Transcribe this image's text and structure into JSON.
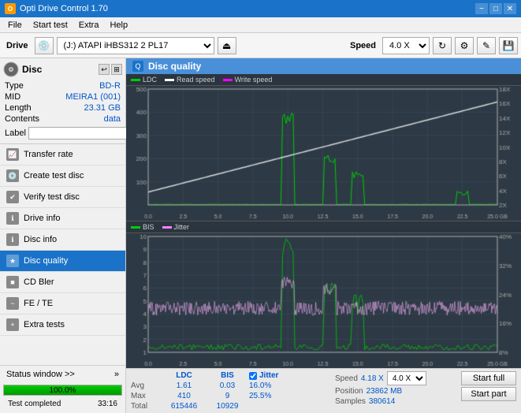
{
  "titleBar": {
    "icon": "O",
    "title": "Opti Drive Control 1.70",
    "minimizeLabel": "−",
    "maximizeLabel": "□",
    "closeLabel": "✕"
  },
  "menuBar": {
    "items": [
      "File",
      "Start test",
      "Extra",
      "Help"
    ]
  },
  "toolbar": {
    "driveLabel": "Drive",
    "driveValue": "(J:)  ATAPI iHBS312  2 PL17",
    "speedLabel": "Speed",
    "speedValue": "4.0 X"
  },
  "disc": {
    "title": "Disc",
    "type": {
      "label": "Type",
      "value": "BD-R"
    },
    "mid": {
      "label": "MID",
      "value": "MEIRA1 (001)"
    },
    "length": {
      "label": "Length",
      "value": "23.31 GB"
    },
    "contents": {
      "label": "Contents",
      "value": "data"
    },
    "label": {
      "label": "Label",
      "placeholder": ""
    }
  },
  "nav": {
    "items": [
      {
        "id": "transfer-rate",
        "label": "Transfer rate",
        "active": false
      },
      {
        "id": "create-test-disc",
        "label": "Create test disc",
        "active": false
      },
      {
        "id": "verify-test-disc",
        "label": "Verify test disc",
        "active": false
      },
      {
        "id": "drive-info",
        "label": "Drive info",
        "active": false
      },
      {
        "id": "disc-info",
        "label": "Disc info",
        "active": false
      },
      {
        "id": "disc-quality",
        "label": "Disc quality",
        "active": true
      },
      {
        "id": "cd-bler",
        "label": "CD Bler",
        "active": false
      },
      {
        "id": "fe-te",
        "label": "FE / TE",
        "active": false
      },
      {
        "id": "extra-tests",
        "label": "Extra tests",
        "active": false
      }
    ]
  },
  "statusSection": {
    "buttonLabel": "Status window >>",
    "progressPercent": 100,
    "progressText": "100.0%",
    "statusText": "Test completed",
    "timeText": "33:16"
  },
  "discQuality": {
    "title": "Disc quality",
    "legend": {
      "ldc": {
        "label": "LDC",
        "color": "#00aa00"
      },
      "readSpeed": {
        "label": "Read speed",
        "color": "#ffffff"
      },
      "writeSpeed": {
        "label": "Write speed",
        "color": "#ff00ff"
      },
      "bis": {
        "label": "BIS",
        "color": "#00aa00"
      },
      "jitter": {
        "label": "Jitter",
        "color": "#ff80ff"
      }
    }
  },
  "stats": {
    "headers": {
      "ldc": "LDC",
      "bis": "BIS",
      "jitter": "Jitter",
      "speed": "Speed",
      "speedVal": "4.18 X",
      "speedSelect": "4.0 X"
    },
    "avg": {
      "label": "Avg",
      "ldc": "1.61",
      "bis": "0.03",
      "jitter": "16.0%"
    },
    "max": {
      "label": "Max",
      "ldc": "410",
      "bis": "9",
      "jitter": "25.5%"
    },
    "total": {
      "label": "Total",
      "ldc": "615446",
      "bis": "10929",
      "jitter": ""
    },
    "position": {
      "label": "Position",
      "value": "23862 MB"
    },
    "samples": {
      "label": "Samples",
      "value": "380614"
    },
    "startFullLabel": "Start full",
    "startPartLabel": "Start part"
  },
  "chartTop": {
    "yAxisMax": 500,
    "yAxisRight": [
      "18X",
      "16X",
      "14X",
      "12X",
      "10X",
      "8X",
      "6X",
      "4X",
      "2X"
    ],
    "xAxisLabels": [
      "0.0",
      "2.5",
      "5.0",
      "7.5",
      "10.0",
      "12.5",
      "15.0",
      "17.5",
      "20.0",
      "22.5",
      "25.0 GB"
    ]
  },
  "chartBottom": {
    "yAxisMax": 10,
    "yAxisRight": [
      "40%",
      "32%",
      "24%",
      "16%",
      "8%"
    ],
    "xAxisLabels": [
      "0.0",
      "2.5",
      "5.0",
      "7.5",
      "10.0",
      "12.5",
      "15.0",
      "17.5",
      "20.0",
      "22.5",
      "25.0 GB"
    ]
  }
}
